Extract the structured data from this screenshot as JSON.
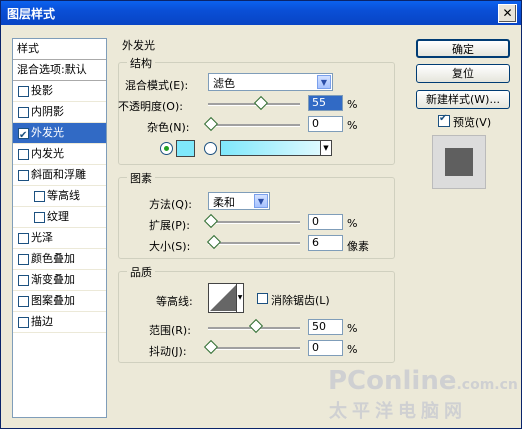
{
  "window": {
    "title": "图层样式",
    "close_icon": "close-icon"
  },
  "sidebar": {
    "header": "样式",
    "blend": "混合选项:默认",
    "items": [
      {
        "label": "投影",
        "checked": false
      },
      {
        "label": "内阴影",
        "checked": false
      },
      {
        "label": "外发光",
        "checked": true
      },
      {
        "label": "内发光",
        "checked": false
      },
      {
        "label": "斜面和浮雕",
        "checked": false
      },
      {
        "label": "等高线",
        "checked": false
      },
      {
        "label": "纹理",
        "checked": false
      },
      {
        "label": "光泽",
        "checked": false
      },
      {
        "label": "颜色叠加",
        "checked": false
      },
      {
        "label": "渐变叠加",
        "checked": false
      },
      {
        "label": "图案叠加",
        "checked": false
      },
      {
        "label": "描边",
        "checked": false
      }
    ]
  },
  "panel": {
    "title": "外发光",
    "structure": {
      "title": "结构",
      "blend_mode_label": "混合模式(E):",
      "blend_mode": "滤色",
      "opacity_label": "不透明度(O):",
      "opacity": "55",
      "noise_label": "杂色(N):",
      "noise": "0",
      "percent": "%"
    },
    "elements": {
      "title": "图素",
      "method_label": "方法(Q):",
      "method": "柔和",
      "spread_label": "扩展(P):",
      "spread": "0",
      "size_label": "大小(S):",
      "size": "6",
      "percent": "%",
      "pixels": "像素"
    },
    "quality": {
      "title": "品质",
      "contour_label": "等高线:",
      "antialias_label": "消除锯齿(L)",
      "range_label": "范围(R):",
      "range": "50",
      "jitter_label": "抖动(J):",
      "jitter": "0",
      "percent": "%"
    }
  },
  "buttons": {
    "ok": "确定",
    "reset": "复位",
    "new_style": "新建样式(W)...",
    "preview": "预览(V)"
  },
  "watermark": {
    "brand": "PConline",
    "domain": ".com.cn",
    "chinese": "太平洋电脑网"
  }
}
